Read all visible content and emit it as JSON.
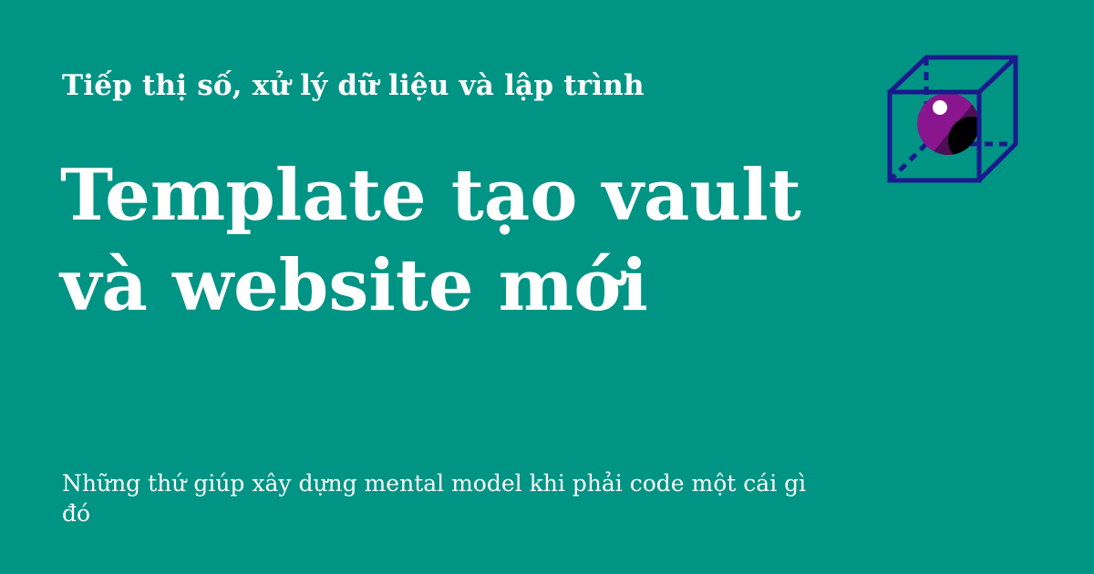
{
  "site": {
    "name": "Tiếp thị số, xử lý dữ liệu và lập trình"
  },
  "post": {
    "title_lines": [
      "Template tạo vault",
      "và website mới"
    ],
    "description": "Những thứ giúp xây dựng mental model khi phải code một cái gì đó"
  },
  "logo": {
    "icon": "cube-with-sphere-icon",
    "colors": {
      "background": "#009485",
      "cube_stroke": "#1a1a8c",
      "sphere": "#8a168f",
      "sphere_shadow": "#000000",
      "highlight": "#ffffff"
    }
  }
}
